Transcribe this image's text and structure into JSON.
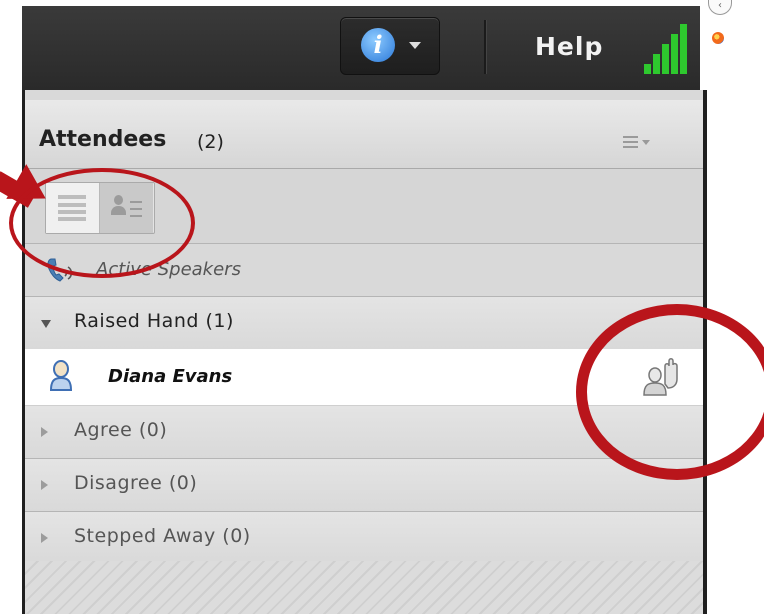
{
  "topbar": {
    "info_glyph": "i",
    "help_label": "Help"
  },
  "panel": {
    "title": "Attendees",
    "count": "(2)"
  },
  "active_speakers": {
    "label": "Active Speakers"
  },
  "groups": [
    {
      "label": "Raised Hand (1)",
      "expanded": true
    },
    {
      "label": "Agree (0)",
      "expanded": false
    },
    {
      "label": "Disagree (0)",
      "expanded": false
    },
    {
      "label": "Stepped Away (0)",
      "expanded": false
    }
  ],
  "attendees": [
    {
      "name": "Diana Evans",
      "status_icon": "raised-hand-icon"
    }
  ],
  "colors": {
    "annotation_red": "#b9151b",
    "signal_green": "#2ec82e",
    "info_blue": "#2a78d8"
  }
}
